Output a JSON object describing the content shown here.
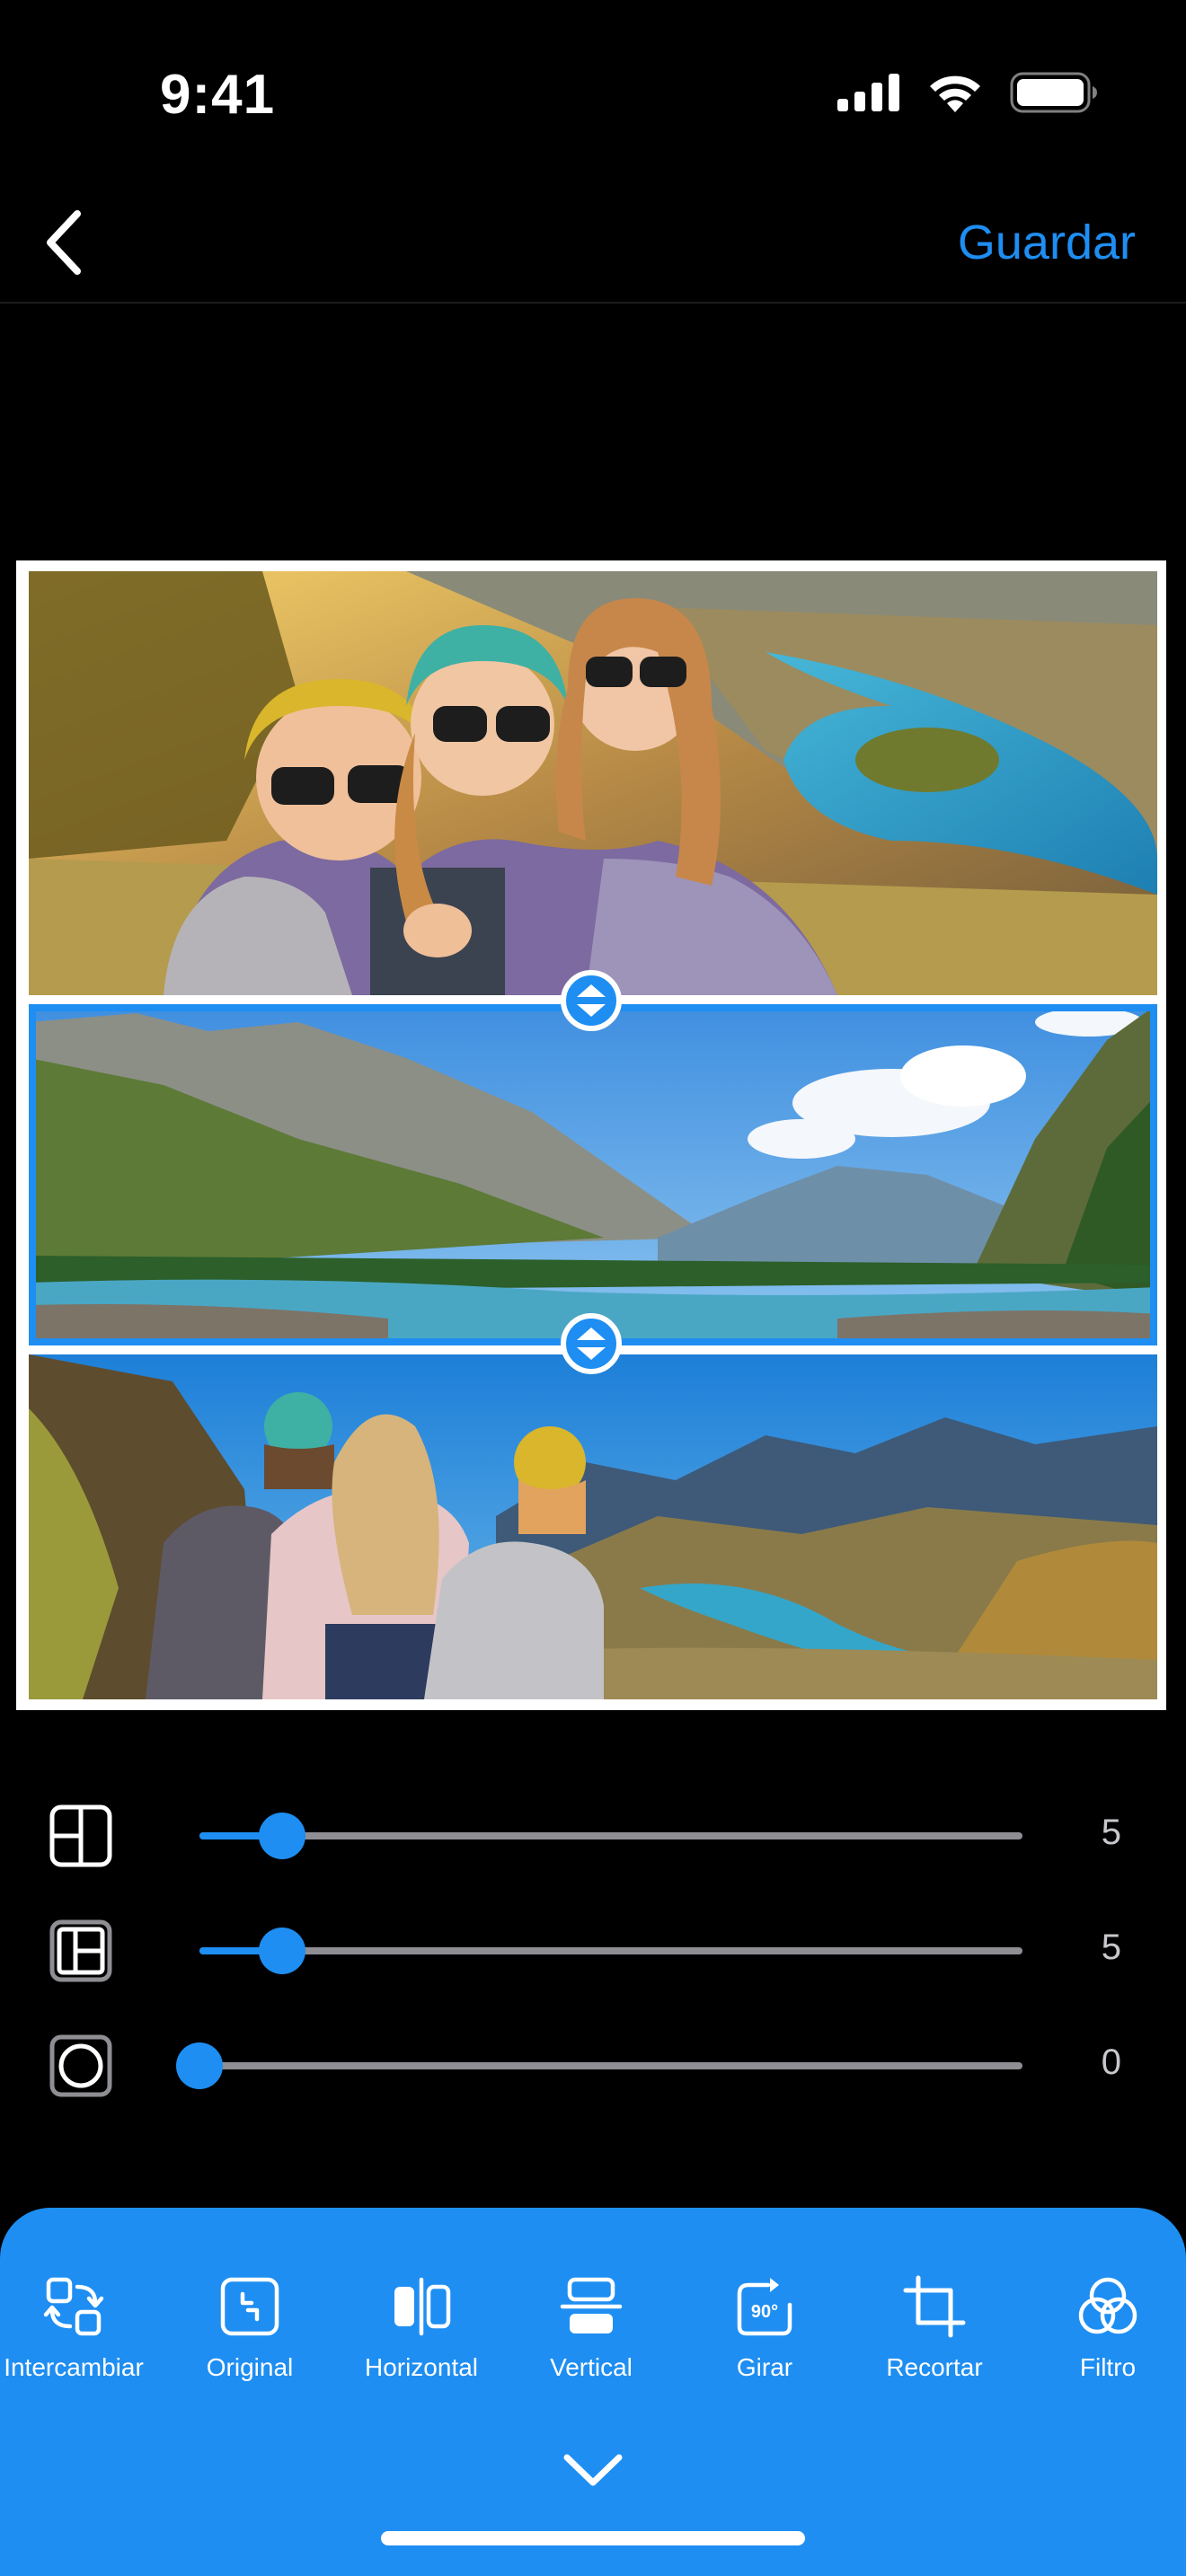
{
  "status_bar": {
    "time": "9:41"
  },
  "nav": {
    "save_label": "Guardar"
  },
  "sliders": [
    {
      "icon": "inner-border-icon",
      "value": "5",
      "level": 0.1
    },
    {
      "icon": "outer-border-icon",
      "value": "5",
      "level": 0.1
    },
    {
      "icon": "corner-radius-icon",
      "value": "0",
      "level": 0.0
    }
  ],
  "toolbar": {
    "tools": [
      {
        "icon": "swap-icon",
        "label": "Intercambiar"
      },
      {
        "icon": "original-icon",
        "label": "Original"
      },
      {
        "icon": "flip-horizontal-icon",
        "label": "Horizontal"
      },
      {
        "icon": "flip-vertical-icon",
        "label": "Vertical"
      },
      {
        "icon": "rotate-90-icon",
        "label": "Girar",
        "badge": "90°"
      },
      {
        "icon": "crop-icon",
        "label": "Recortar"
      },
      {
        "icon": "filter-icon",
        "label": "Filtro"
      }
    ]
  },
  "colors": {
    "accent": "#1e8ef2",
    "background": "#000000",
    "track": "#8e8e93"
  }
}
